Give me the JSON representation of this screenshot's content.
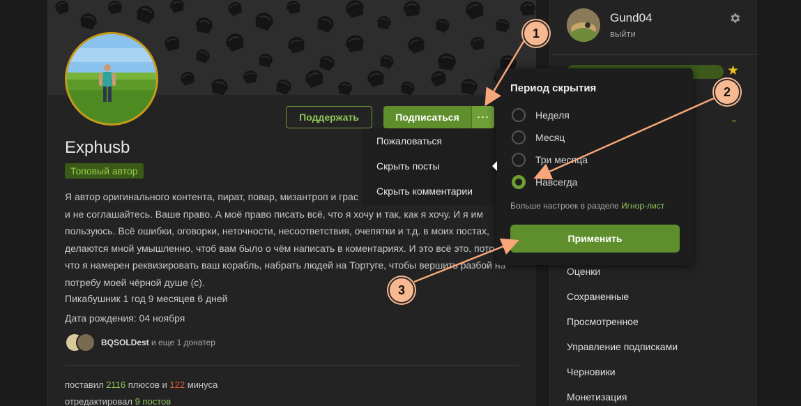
{
  "profile": {
    "username": "Exphusb",
    "badge": "Топовый автор",
    "support_label": "Поддержать",
    "subscribe_label": "Подписаться",
    "more_label": "⋯",
    "bio": "Я автор оригинального контента, пират, повар, мизантроп и грас... не соглашайтесь. Ваше право. А моё право писать всё, что я хочу и так, как я хочу. И я им пользуюсь. Всё ошибки, оговорки, неточности, несоответствия, очепятки и т.д. в моих постах, делаются мной умышленно, чтоб вам было о чём написать в коментариях. И это всё это, пото... что я намерен реквизировать ваш корабль, набрать людей на Тортуге, чтобы вершить разбой на потребу моей чёрной душе (с).",
    "bio_lines": [
      "Я автор оригинального контента, пират, повар, мизантроп и грас",
      "и не соглашайтесь. Ваше право. А моё право писать всё, что я хочу и так, как я хочу. И я им",
      "пользуюсь. Всё ошибки, оговорки, неточности, несоответствия, очепятки и т.д. в моих постах,",
      "делаются мной умышленно, чтоб вам было о чём написать в коментариях. И это всё это, пото",
      "что я намерен реквизировать ваш корабль, набрать людей на Тортуге, чтобы вершить разбой на",
      "потребу моей чёрной душе (с)."
    ],
    "pikabu_age": "Пикабушник 1 год 9 месяцев 6 дней",
    "birthday": "Дата рождения: 04 ноября",
    "donater_name": "BQSOLDest",
    "donater_more": " и еще 1 донатер",
    "stats": {
      "line1_prefix": "поставил ",
      "pluses": "2116",
      "line1_mid": " плюсов и ",
      "minuses": "122",
      "line1_suffix": " минуса",
      "line2_prefix": "отредактировал ",
      "posts": "9 постов"
    }
  },
  "more_menu": {
    "items": [
      "Пожаловаться",
      "Скрыть посты",
      "Скрыть комментарии"
    ]
  },
  "hide_popup": {
    "title": "Период скрытия",
    "options": [
      "Неделя",
      "Месяц",
      "Три месяца",
      "Навсегда"
    ],
    "selected": "Навсегда",
    "note_prefix": "Больше настроек в разделе ",
    "note_link": "Игнор-лист",
    "apply_label": "Применить"
  },
  "sidebar": {
    "user_name": "Gund04",
    "logout_label": "выйти",
    "nav_items": [
      "Оценки",
      "Сохраненные",
      "Просмотренное",
      "Управление подписками",
      "Черновики",
      "Монетизация"
    ]
  },
  "callouts": [
    "1",
    "2",
    "3"
  ],
  "colors": {
    "accent_green": "#5f8f2c",
    "link_green": "#8fc457",
    "minus_red": "#e05a3a",
    "callout": "#f8b890",
    "star": "#f2c21b"
  },
  "icons": [
    "gear-icon",
    "star-icon",
    "chevron-down-icon",
    "more-icon"
  ]
}
